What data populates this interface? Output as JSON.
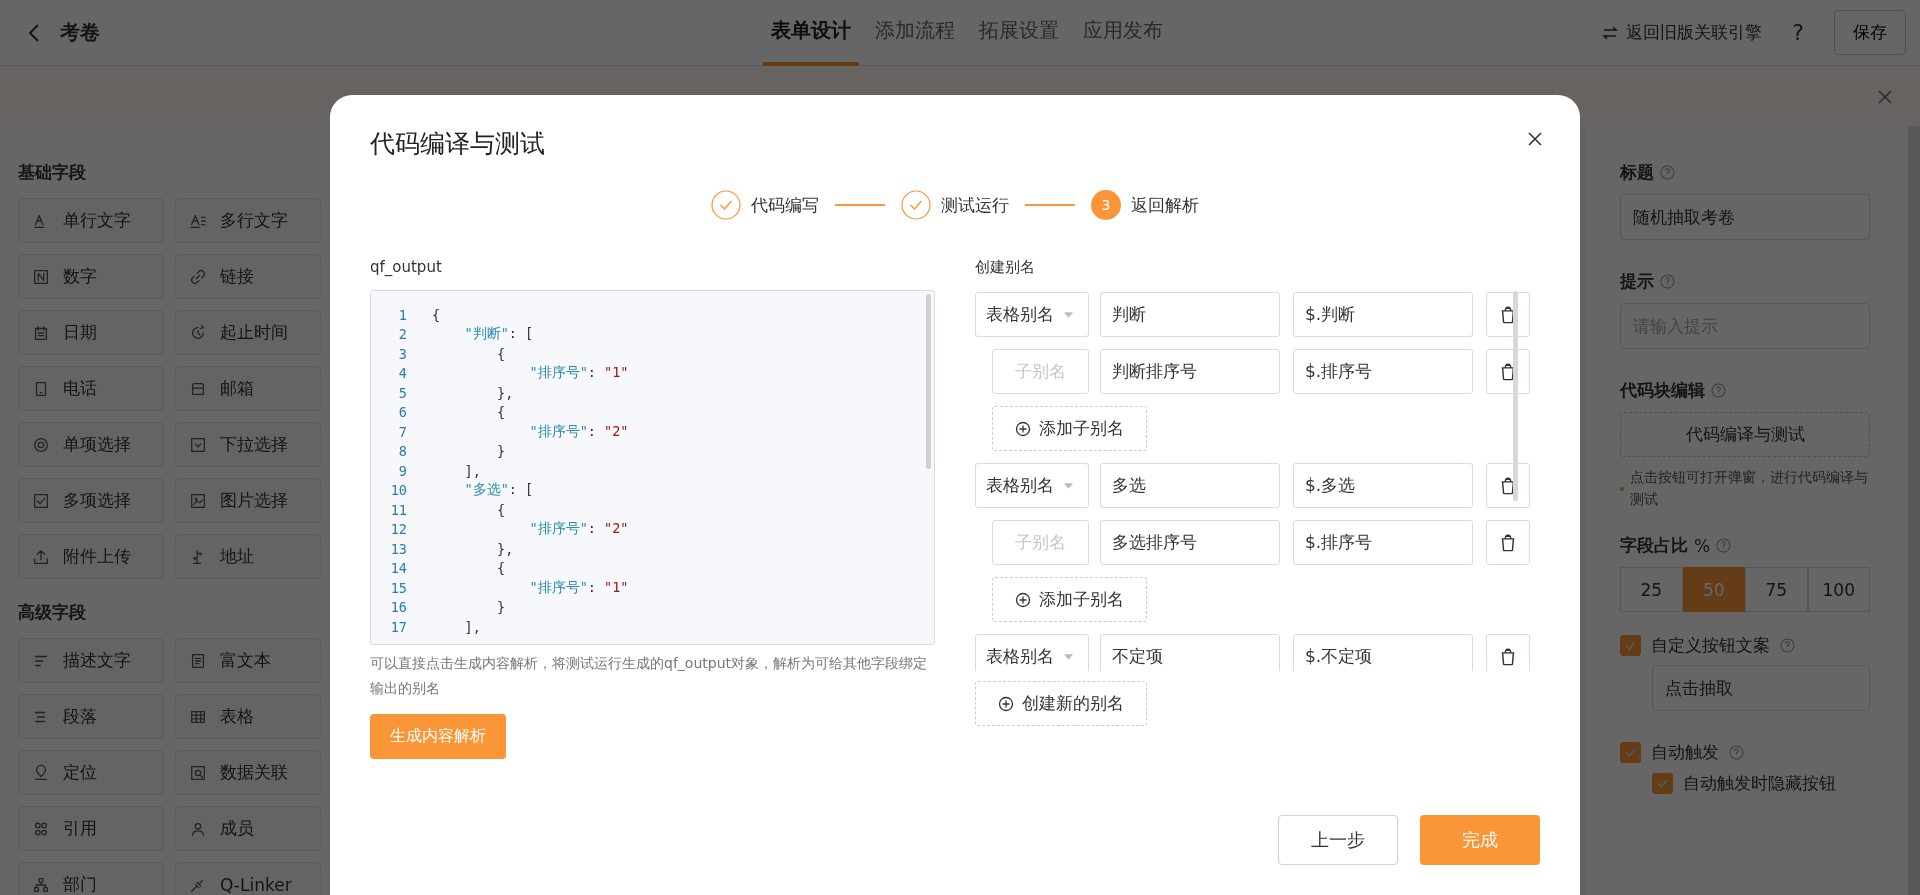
{
  "header": {
    "title": "考卷",
    "tabs": [
      {
        "label": "表单设计",
        "selected": true
      },
      {
        "label": "添加流程",
        "selected": false
      },
      {
        "label": "拓展设置",
        "selected": false
      },
      {
        "label": "应用发布",
        "selected": false
      }
    ],
    "legacy_link": "返回旧版关联引擎",
    "help": "?",
    "save": "保存"
  },
  "banner": {
    "closable": true
  },
  "sidebar": {
    "sections": [
      {
        "title": "基础字段",
        "items": [
          "单行文字",
          "多行文字",
          "数字",
          "链接",
          "日期",
          "起止时间",
          "电话",
          "邮箱",
          "单项选择",
          "下拉选择",
          "多项选择",
          "图片选择",
          "附件上传",
          "地址"
        ]
      },
      {
        "title": "高级字段",
        "items": [
          "描述文字",
          "富文本",
          "段落",
          "表格",
          "定位",
          "数据关联",
          "引用",
          "成员",
          "部门",
          "Q-Linker"
        ]
      }
    ]
  },
  "properties": {
    "title_label": "标题",
    "title_value": "随机抽取考卷",
    "hint_label": "提示",
    "hint_placeholder": "请输入提示",
    "code_label": "代码块编辑",
    "code_button": "代码编译与测试",
    "code_note": "点击按钮可打开弹窗，进行代码编译与测试",
    "ratio_label": "字段占比",
    "ratio_unit": "%",
    "ratios": [
      {
        "label": "25",
        "selected": false
      },
      {
        "label": "50",
        "selected": true
      },
      {
        "label": "75",
        "selected": false
      },
      {
        "label": "100",
        "selected": false
      }
    ],
    "checks": [
      {
        "label": "自定义按钮文案",
        "checked": true,
        "help": true,
        "value": "点击抽取",
        "nested": false
      },
      {
        "label": "自动触发",
        "checked": true,
        "help": true,
        "nested": false
      },
      {
        "label": "自动触发时隐藏按钮",
        "checked": true,
        "help": false,
        "nested": true
      }
    ]
  },
  "dialog": {
    "title": "代码编译与测试",
    "steps": [
      {
        "label": "代码编写",
        "done": true
      },
      {
        "label": "测试运行",
        "done": true
      },
      {
        "label": "返回解析",
        "done": false,
        "number": "3"
      }
    ],
    "output_label": "qf_output",
    "code": [
      {
        "number": "1",
        "parts": [
          {
            "kind": "punct",
            "text": "{"
          }
        ]
      },
      {
        "number": "2",
        "parts": [
          {
            "kind": "key",
            "text": "    \"判断\""
          },
          {
            "kind": "punct",
            "text": ": ["
          }
        ]
      },
      {
        "number": "3",
        "parts": [
          {
            "kind": "punct",
            "text": "        {"
          }
        ]
      },
      {
        "number": "4",
        "parts": [
          {
            "kind": "key",
            "text": "            \"排序号\""
          },
          {
            "kind": "punct",
            "text": ": "
          },
          {
            "kind": "string",
            "text": "\"1\""
          }
        ]
      },
      {
        "number": "5",
        "parts": [
          {
            "kind": "punct",
            "text": "        },"
          }
        ]
      },
      {
        "number": "6",
        "parts": [
          {
            "kind": "punct",
            "text": "        {"
          }
        ]
      },
      {
        "number": "7",
        "parts": [
          {
            "kind": "key",
            "text": "            \"排序号\""
          },
          {
            "kind": "punct",
            "text": ": "
          },
          {
            "kind": "string",
            "text": "\"2\""
          }
        ]
      },
      {
        "number": "8",
        "parts": [
          {
            "kind": "punct",
            "text": "        }"
          }
        ]
      },
      {
        "number": "9",
        "parts": [
          {
            "kind": "punct",
            "text": "    ],"
          }
        ]
      },
      {
        "number": "10",
        "parts": [
          {
            "kind": "key",
            "text": "    \"多选\""
          },
          {
            "kind": "punct",
            "text": ": ["
          }
        ]
      },
      {
        "number": "11",
        "parts": [
          {
            "kind": "punct",
            "text": "        {"
          }
        ]
      },
      {
        "number": "12",
        "parts": [
          {
            "kind": "key",
            "text": "            \"排序号\""
          },
          {
            "kind": "punct",
            "text": ": "
          },
          {
            "kind": "string",
            "text": "\"2\""
          }
        ]
      },
      {
        "number": "13",
        "parts": [
          {
            "kind": "punct",
            "text": "        },"
          }
        ]
      },
      {
        "number": "14",
        "parts": [
          {
            "kind": "punct",
            "text": "        {"
          }
        ]
      },
      {
        "number": "15",
        "parts": [
          {
            "kind": "key",
            "text": "            \"排序号\""
          },
          {
            "kind": "punct",
            "text": ": "
          },
          {
            "kind": "string",
            "text": "\"1\""
          }
        ]
      },
      {
        "number": "16",
        "parts": [
          {
            "kind": "punct",
            "text": "        }"
          }
        ]
      },
      {
        "number": "17",
        "parts": [
          {
            "kind": "punct",
            "text": "    ],"
          }
        ]
      }
    ],
    "help_text": "可以直接点击生成内容解析，将测试运行生成的qf_output对象，解析为可给其他字段绑定输出的别名",
    "parse_button": "生成内容解析",
    "alias_label": "创建别名",
    "aliases": [
      {
        "kind": "parent",
        "type": "表格别名",
        "name": "判断",
        "path": "$.判断"
      },
      {
        "kind": "child",
        "placeholder": "子别名",
        "name": "判断排序号",
        "path": "$.排序号"
      },
      {
        "kind": "add",
        "label": "添加子别名"
      },
      {
        "kind": "parent",
        "type": "表格别名",
        "name": "多选",
        "path": "$.多选"
      },
      {
        "kind": "child",
        "placeholder": "子别名",
        "name": "多选排序号",
        "path": "$.排序号"
      },
      {
        "kind": "add",
        "label": "添加子别名"
      },
      {
        "kind": "parent",
        "type": "表格别名",
        "name": "不定项",
        "path": "$.不定项"
      }
    ],
    "new_alias": "创建新的别名",
    "prev": "上一步",
    "finish": "完成"
  }
}
